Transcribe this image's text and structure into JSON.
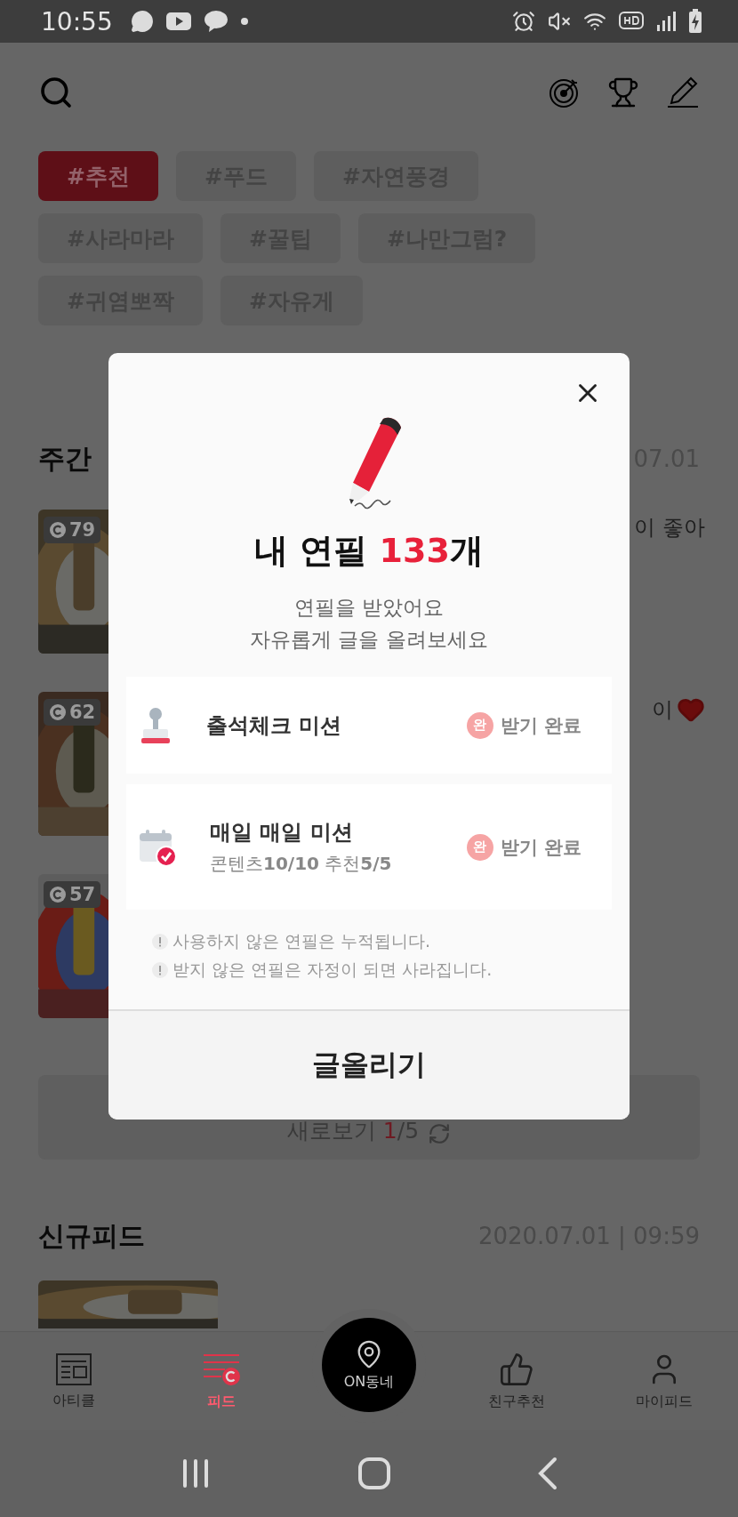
{
  "status_bar": {
    "time": "10:55"
  },
  "tags": [
    {
      "label": "#추천",
      "selected": true
    },
    {
      "label": "#푸드",
      "selected": false
    },
    {
      "label": "#자연풍경",
      "selected": false
    },
    {
      "label": "#사라마라",
      "selected": false
    },
    {
      "label": "#꿀팁",
      "selected": false
    },
    {
      "label": "#나만그럼?",
      "selected": false
    },
    {
      "label": "#귀염뽀짝",
      "selected": false
    },
    {
      "label": "#자유게",
      "selected": false
    }
  ],
  "weekly": {
    "title": "주간",
    "date": "07.01",
    "items": [
      {
        "count": "79",
        "snippet": "이 좋아",
        "liked": false
      },
      {
        "count": "62",
        "snippet": "이",
        "liked": true
      },
      {
        "count": "57",
        "liked": false
      }
    ]
  },
  "more_button": {
    "label": "새로보기",
    "current": "1",
    "total": "/5"
  },
  "new_feed": {
    "title": "신규피드",
    "date": "2020.07.01 | 09:59"
  },
  "modal": {
    "title": "내 연필",
    "count": "133",
    "unit": "개",
    "subtitle": [
      "연필을 받았어요",
      "자유롭게 글을 올려보세요"
    ],
    "missions": [
      {
        "kind": "stamp",
        "title": "출석체크 미션",
        "badge": "완",
        "status": "받기 완료",
        "completed": true
      },
      {
        "kind": "calendar",
        "title": "매일 매일 미션",
        "progress": "콘텐츠**10/10**  추천**5/5**",
        "badge": "완",
        "status": "받기 완료",
        "completed": true
      }
    ],
    "notes": [
      "사용하지 않은 연필은 누적됩니다.",
      "받지 않은 연필은 자정이 되면 사라집니다."
    ],
    "action": "글올리기"
  },
  "bottom_nav": [
    {
      "kind": "tab",
      "label": "아티클",
      "selected": false
    },
    {
      "kind": "tab",
      "label": "피드",
      "selected": true
    },
    {
      "kind": "center",
      "label": "ON동네",
      "selected": false
    },
    {
      "kind": "tab",
      "label": "친구추천",
      "selected": false
    },
    {
      "kind": "tab",
      "label": "마이피드",
      "selected": false
    }
  ]
}
